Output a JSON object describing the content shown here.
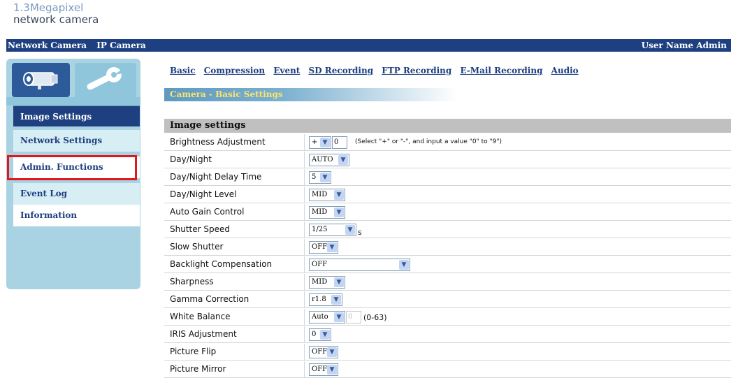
{
  "logo": {
    "line1": "1.3Megapixel",
    "line2": "network camera"
  },
  "topbar": {
    "left_items": [
      "Network Camera",
      "IP Camera"
    ],
    "user": "User Name Admin"
  },
  "sidebar": {
    "tabs": [
      {
        "icon": "camera-icon"
      },
      {
        "icon": "wrench-icon"
      }
    ],
    "items": [
      {
        "label": "Image Settings",
        "state": "active"
      },
      {
        "label": "Network Settings",
        "state": "normal"
      },
      {
        "label": "Admin. Functions",
        "state": "highlighted"
      },
      {
        "label": "Event Log",
        "state": "normal"
      },
      {
        "label": "Information",
        "state": "normal"
      }
    ]
  },
  "subnav": [
    "Basic",
    "Compression",
    "Event",
    "SD Recording",
    "FTP Recording",
    "E-Mail Recording",
    "Audio"
  ],
  "section_title": "Camera - Basic Settings",
  "settings": {
    "header": "Image settings",
    "rows": [
      {
        "label": "Brightness Adjustment",
        "sign": "+",
        "value": "0",
        "note": "(Select \"+\" or \"-\", and input a value \"0\" to \"9\")"
      },
      {
        "label": "Day/Night",
        "value": "AUTO"
      },
      {
        "label": "Day/Night Delay Time",
        "value": "5"
      },
      {
        "label": "Day/Night Level",
        "value": "MID"
      },
      {
        "label": "Auto Gain Control",
        "value": "MID"
      },
      {
        "label": "Shutter Speed",
        "value": "1/25",
        "unit": "s"
      },
      {
        "label": "Slow Shutter",
        "value": "OFF"
      },
      {
        "label": "Backlight Compensation",
        "value": "OFF"
      },
      {
        "label": "Sharpness",
        "value": "MID"
      },
      {
        "label": "Gamma Correction",
        "value": "r1.8"
      },
      {
        "label": "White Balance",
        "value": "Auto",
        "extra": "0",
        "note": "(0-63)"
      },
      {
        "label": "IRIS Adjustment",
        "value": "0"
      },
      {
        "label": "Picture Flip",
        "value": "OFF"
      },
      {
        "label": "Picture Mirror",
        "value": "OFF"
      }
    ]
  },
  "colors": {
    "nav_bg": "#1e3f80",
    "sidebar_bg": "#a9d3e3",
    "highlight": "#e0171b",
    "section_title": "#ffe36a"
  }
}
